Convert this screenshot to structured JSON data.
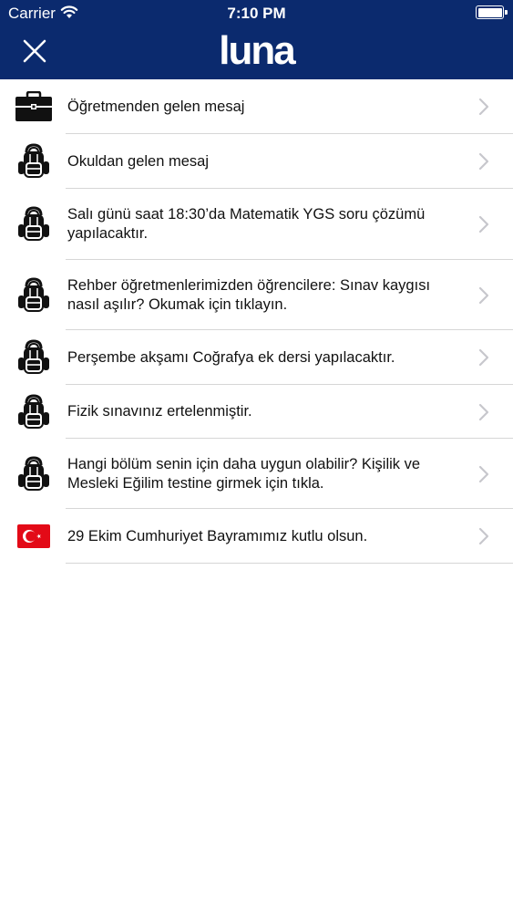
{
  "status_bar": {
    "carrier": "Carrier",
    "time": "7:10 PM"
  },
  "header": {
    "logo_text": "luna",
    "close_icon": "close-icon",
    "background_color": "#0b2a6e"
  },
  "messages": [
    {
      "icon": "briefcase-icon",
      "text": "Öğretmenden gelen mesaj",
      "height": 60
    },
    {
      "icon": "backpack-icon",
      "text": "Okuldan gelen mesaj",
      "height": 60
    },
    {
      "icon": "backpack-icon",
      "text": "Salı günü saat 18:30’da Matematik YGS soru çözümü yapılacaktır.",
      "height": 78
    },
    {
      "icon": "backpack-icon",
      "text": "Rehber öğretmenlerimizden öğrencilere: Sınav kaygısı nasıl aşılır? Okumak için tıklayın.",
      "height": 77
    },
    {
      "icon": "backpack-icon",
      "text": "Perşembe akşamı Coğrafya ek dersi yapılacaktır.",
      "height": 60
    },
    {
      "icon": "backpack-icon",
      "text": "Fizik sınavınız ertelenmiştir.",
      "height": 59
    },
    {
      "icon": "backpack-icon",
      "text": "Hangi bölüm senin için daha uygun olabilir? Kişilik ve Mesleki Eğilim testine girmek için tıkla.",
      "height": 77
    },
    {
      "icon": "turkish-flag-icon",
      "text": "29 Ekim Cumhuriyet Bayramımız kutlu olsun.",
      "height": 60
    }
  ]
}
